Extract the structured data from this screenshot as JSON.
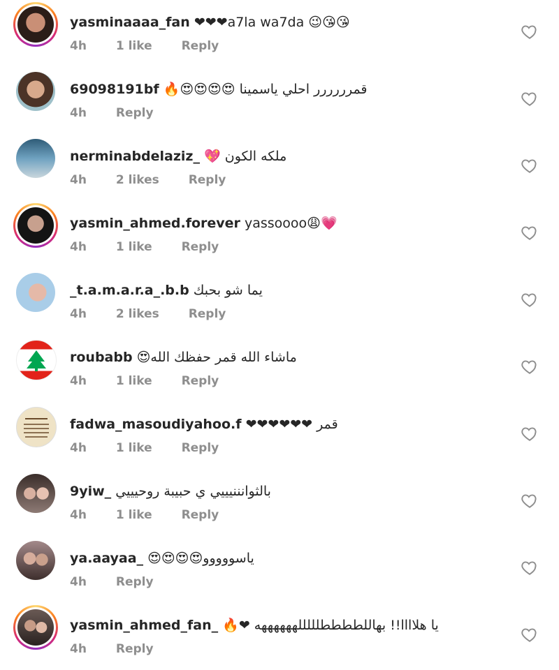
{
  "comments": [
    {
      "username": "yasminaaaa_fan",
      "text": "❤❤❤a7la wa7da 😉😘😘",
      "time": "4h",
      "likes": "1 like",
      "reply": "Reply",
      "story": true,
      "avatar_color": "#3b2a22"
    },
    {
      "username": "69098191bf",
      "text": "قمرررررر احلي ياسمينا 😍😍😍😍🔥",
      "time": "4h",
      "likes": "",
      "reply": "Reply",
      "story": false,
      "avatar_color": "#7a5a4a"
    },
    {
      "username": "nerminabdelaziz_",
      "text": "ملكه الكون 💖",
      "time": "4h",
      "likes": "2 likes",
      "reply": "Reply",
      "story": false,
      "avatar_color": "#4a7d99"
    },
    {
      "username": "yasmin_ahmed.forever",
      "text": "yassoooo😩💗",
      "time": "4h",
      "likes": "1 like",
      "reply": "Reply",
      "story": true,
      "avatar_color": "#222222"
    },
    {
      "username": "_t.a.m.a.r.a_.b.b",
      "text": "يما شو بحبك",
      "time": "4h",
      "likes": "2 likes",
      "reply": "Reply",
      "story": false,
      "avatar_color": "#bcd7ee"
    },
    {
      "username": "roubabb",
      "text": "ماشاء الله قمر حفظك الله😍",
      "time": "4h",
      "likes": "1 like",
      "reply": "Reply",
      "story": false,
      "avatar_color": "#ffffff"
    },
    {
      "username": "fadwa_masoudiyahoo.f",
      "text": "قمر ❤❤❤❤❤❤",
      "time": "4h",
      "likes": "1 like",
      "reply": "Reply",
      "story": false,
      "avatar_color": "#e8dcc0"
    },
    {
      "username": "9yiw_",
      "text": "بالثوانننيييي ي حبيبة روحيييي",
      "time": "4h",
      "likes": "1 like",
      "reply": "Reply",
      "story": false,
      "avatar_color": "#6b5a55"
    },
    {
      "username": "ya.aayaa_",
      "text": "ياسووووو😍😍😍😍",
      "time": "4h",
      "likes": "",
      "reply": "Reply",
      "story": false,
      "avatar_color": "#5a4a48"
    },
    {
      "username": "yasmin_ahmed_fan_",
      "text": "يا هلاااا!! بهاللططططلللللههههههه ❤🔥",
      "time": "4h",
      "likes": "",
      "reply": "Reply",
      "story": true,
      "avatar_color": "#4a3d3a"
    }
  ],
  "icons": {
    "like": "heart-outline-icon"
  }
}
